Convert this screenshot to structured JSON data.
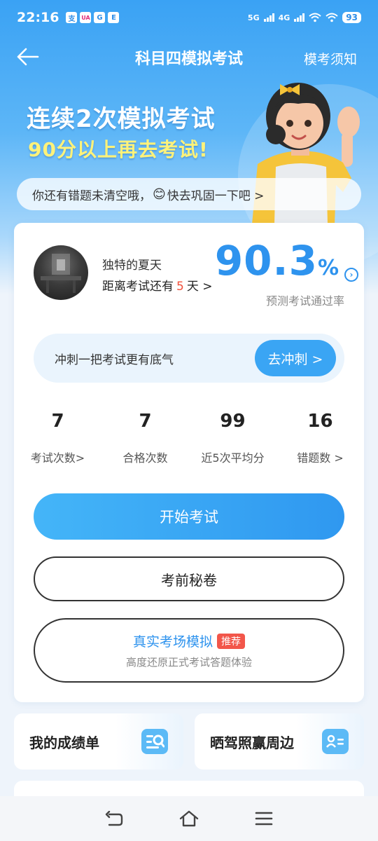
{
  "status_bar": {
    "time": "22:16",
    "apps": [
      "支",
      "UA",
      "G",
      "E"
    ],
    "network_1": "5G",
    "network_2": "4G",
    "battery": "93"
  },
  "nav": {
    "title": "科目四模拟考试",
    "right_link": "模考须知"
  },
  "banner": {
    "line1": "连续2次模拟考试",
    "line2": "90分以上再去考试!"
  },
  "notice": {
    "text_before": "你还有错题未清空哦，",
    "emoji": "😊",
    "text_after": "快去巩固一下吧 >"
  },
  "profile": {
    "name": "独特的夏天",
    "countdown_prefix": "距离考试还有",
    "countdown_days": "5",
    "countdown_suffix": "天 >"
  },
  "pass_rate": {
    "value": "90.3",
    "unit": "%",
    "label": "预测考试通过率"
  },
  "sprint": {
    "text": "冲刺一把考试更有底气",
    "button": "去冲刺 >"
  },
  "stats": [
    {
      "value": "7",
      "label": "考试次数>"
    },
    {
      "value": "7",
      "label": "合格次数"
    },
    {
      "value": "99",
      "label": "近5次平均分"
    },
    {
      "value": "16",
      "label": "错题数 >"
    }
  ],
  "buttons": {
    "start": "开始考试",
    "secret": "考前秘卷",
    "real_title": "真实考场模拟",
    "real_badge": "推荐",
    "real_sub": "高度还原正式考试答题体验"
  },
  "tiles": {
    "scores": "我的成绩单",
    "share": "晒驾照赢周边"
  },
  "colors": {
    "accent": "#2e93ee",
    "highlight": "#f2503b",
    "banner_yellow": "#fff27a"
  }
}
